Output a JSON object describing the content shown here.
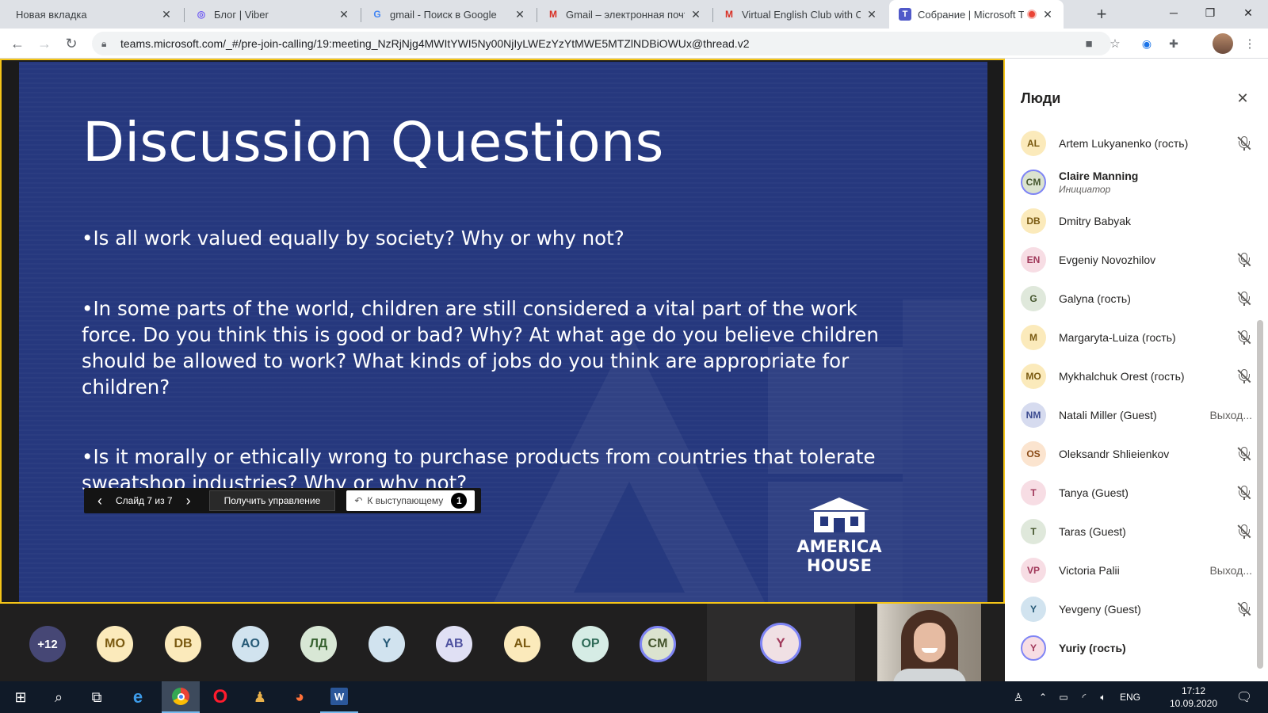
{
  "browser": {
    "tabs": [
      {
        "title": "Новая вкладка",
        "favicon": "blank-icon",
        "active": false
      },
      {
        "title": "Блог | Viber",
        "favicon": "viber-icon",
        "active": false
      },
      {
        "title": "gmail - Поиск в Google",
        "favicon": "google-icon",
        "active": false
      },
      {
        "title": "Gmail – электронная почта",
        "favicon": "gmail-icon",
        "active": false
      },
      {
        "title": "Virtual English Club with Clai",
        "favicon": "gmail-icon",
        "active": false
      },
      {
        "title": "Собрание | Microsoft Te",
        "favicon": "teams-icon",
        "active": true,
        "recording": true
      }
    ],
    "url": "teams.microsoft.com/_#/pre-join-calling/19:meeting_NzRjNjg4MWItYWI5Ny00NjIyLWEzYzYtMWE5MTZlNDBiOWUx@thread.v2"
  },
  "slide": {
    "title": "Discussion Questions",
    "bullets": [
      "•Is all work valued equally by society? Why or why not?",
      "•In some parts of the world, children are still considered a vital part of the work force. Do you think this is good or bad? Why? At what age do you believe children should be allowed to work? What kinds of jobs do you think are appropriate for children?",
      "•Is it morally or ethically wrong to purchase products from countries that tolerate sweatshop industries? Why or why not?"
    ],
    "logo_line1": "AMERICA",
    "logo_line2": "HOUSE",
    "background": "#26387e"
  },
  "slide_controls": {
    "counter": "Слайд 7 из 7",
    "take_control": "Получить управление",
    "to_presenter": "К выступающему",
    "badge": "1"
  },
  "participants_bar": {
    "overflow": "+12",
    "avatars": [
      {
        "initials": "MO",
        "bg": "#fbeabb",
        "fg": "#7a5a11"
      },
      {
        "initials": "DB",
        "bg": "#fbeabb",
        "fg": "#7a5a11"
      },
      {
        "initials": "AO",
        "bg": "#d1e3ef",
        "fg": "#275a77"
      },
      {
        "initials": "ЛД",
        "bg": "#d8e7d5",
        "fg": "#36612f"
      },
      {
        "initials": "Y",
        "bg": "#d1e3ef",
        "fg": "#275a77"
      },
      {
        "initials": "AB",
        "bg": "#e0e0f4",
        "fg": "#4f52a0"
      },
      {
        "initials": "AL",
        "bg": "#fbeabb",
        "fg": "#7a5a11"
      },
      {
        "initials": "OP",
        "bg": "#d6ece5",
        "fg": "#2f6b58"
      },
      {
        "initials": "CM",
        "bg": "#dbe3cf",
        "fg": "#44552d"
      }
    ],
    "self_initials": "Y"
  },
  "people_pane": {
    "title": "Люди",
    "people": [
      {
        "initials": "AL",
        "name": "Artem Lukyanenko (гость)",
        "bg": "#fbeabb",
        "fg": "#7a5a11",
        "status": "muted"
      },
      {
        "initials": "CM",
        "name": "Claire Manning",
        "role": "Инициатор",
        "bg": "#dbe3cf",
        "fg": "#44552d",
        "status": "speaking"
      },
      {
        "initials": "DB",
        "name": "Dmitry Babyak",
        "bg": "#fbeabb",
        "fg": "#7a5a11",
        "status": "none"
      },
      {
        "initials": "EN",
        "name": "Evgeniy Novozhilov",
        "bg": "#f7dde4",
        "fg": "#a0385a",
        "status": "muted"
      },
      {
        "initials": "G",
        "name": "Galyna (гость)",
        "bg": "#dfe8db",
        "fg": "#44552d",
        "status": "muted"
      },
      {
        "initials": "M",
        "name": "Margaryta-Luiza (гость)",
        "bg": "#fbeabb",
        "fg": "#7a5a11",
        "status": "muted"
      },
      {
        "initials": "MO",
        "name": "Mykhalchuk Orest (гость)",
        "bg": "#fbeabb",
        "fg": "#7a5a11",
        "status": "muted"
      },
      {
        "initials": "NM",
        "name": "Natali Miller (Guest)",
        "bg": "#d6dbef",
        "fg": "#3b4a8f",
        "status_text": "Выход..."
      },
      {
        "initials": "OS",
        "name": "Oleksandr Shlieienkov",
        "bg": "#fbe4cf",
        "fg": "#8a4b17",
        "status": "muted"
      },
      {
        "initials": "T",
        "name": "Tanya (Guest)",
        "bg": "#f7dde4",
        "fg": "#a0385a",
        "status": "muted"
      },
      {
        "initials": "T",
        "name": "Taras (Guest)",
        "bg": "#dfe8db",
        "fg": "#44552d",
        "status": "muted"
      },
      {
        "initials": "VP",
        "name": "Victoria Palii",
        "bg": "#f7dde4",
        "fg": "#a0385a",
        "status_text": "Выход..."
      },
      {
        "initials": "Y",
        "name": "Yevgeny (Guest)",
        "bg": "#d1e3ef",
        "fg": "#275a77",
        "status": "muted"
      },
      {
        "initials": "Y",
        "name": "Yuriy (гость)",
        "bg": "#f7dde4",
        "fg": "#a0385a",
        "status": "self"
      }
    ]
  },
  "taskbar": {
    "language": "ENG",
    "time": "17:12",
    "date": "10.09.2020"
  }
}
